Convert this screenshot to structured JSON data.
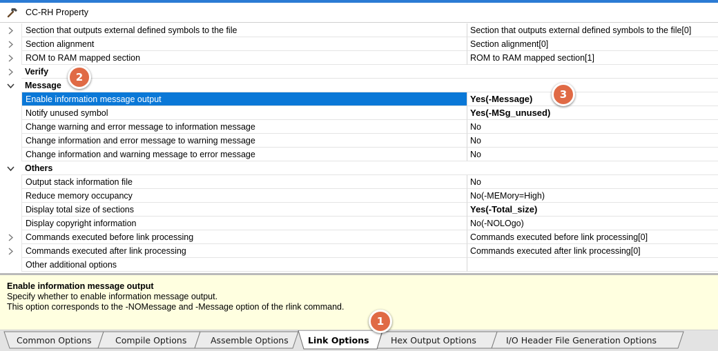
{
  "window": {
    "title": "CC-RH Property",
    "icon": "hammer-icon"
  },
  "rows": [
    {
      "name": "Section that outputs external defined symbols to the file",
      "value": "Section that outputs external defined symbols to the file[0]",
      "expander": "chevron-right-icon"
    },
    {
      "name": "Section alignment",
      "value": "Section alignment[0]",
      "expander": "chevron-right-icon"
    },
    {
      "name": "ROM to RAM mapped section",
      "value": "ROM to RAM mapped section[1]",
      "expander": "chevron-right-icon"
    },
    {
      "name": "Verify",
      "category": true,
      "expander": "chevron-right-icon"
    },
    {
      "name": "Message",
      "category": true,
      "expander": "chevron-down-icon"
    },
    {
      "name": "Enable information message output",
      "value": "Yes(-Message)",
      "bold": true,
      "selected": true
    },
    {
      "name": "Notify unused symbol",
      "value": "Yes(-MSg_unused)",
      "bold": true
    },
    {
      "name": "Change warning and error message to information message",
      "value": "No"
    },
    {
      "name": "Change information and error message to warning message",
      "value": "No"
    },
    {
      "name": "Change information and warning message to error message",
      "value": "No"
    },
    {
      "name": "Others",
      "category": true,
      "expander": "chevron-down-icon"
    },
    {
      "name": "Output stack information file",
      "value": "No"
    },
    {
      "name": "Reduce memory occupancy",
      "value": "No(-MEMory=High)"
    },
    {
      "name": "Display total size of sections",
      "value": "Yes(-Total_size)",
      "bold": true
    },
    {
      "name": "Display copyright information",
      "value": "No(-NOLOgo)"
    },
    {
      "name": "Commands executed before link processing",
      "value": "Commands executed before link processing[0]",
      "expander": "chevron-right-icon"
    },
    {
      "name": "Commands executed after link processing",
      "value": "Commands executed after link processing[0]",
      "expander": "chevron-right-icon"
    },
    {
      "name": "Other additional options",
      "value": ""
    }
  ],
  "description": {
    "title": "Enable information message output",
    "line1": "Specify whether to enable information message output.",
    "line2": "This option corresponds to the -NOMessage and -Message option of the rlink command."
  },
  "tabs": [
    {
      "label": "Common Options",
      "active": false
    },
    {
      "label": "Compile Options",
      "active": false
    },
    {
      "label": "Assemble Options",
      "active": false
    },
    {
      "label": "Link Options",
      "active": true
    },
    {
      "label": "Hex Output Options",
      "active": false
    },
    {
      "label": "I/O Header File Generation Options",
      "active": false
    }
  ],
  "badges": [
    "1",
    "2",
    "3"
  ],
  "colors": {
    "selection": "#0a78d7",
    "description_bg": "#ffffe0",
    "badge": "#e06a45",
    "window_accent": "#2b7bd4"
  }
}
